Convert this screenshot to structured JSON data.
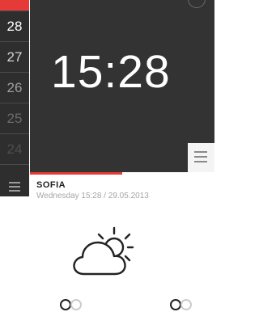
{
  "sidebar": {
    "numbers": [
      "28",
      "27",
      "26",
      "25",
      "24"
    ],
    "colors": [
      "#ffffff",
      "#d4d4d4",
      "#9e9e9e",
      "#6a6a6a",
      "#4e4e4e"
    ],
    "menu_icon": "hamburger-icon"
  },
  "main": {
    "clock": "15:28",
    "top_icon": "circle-button-icon",
    "menu_icon": "hamburger-icon"
  },
  "location": {
    "city": "SOFIA",
    "datetime": "Wednesday 15:28 / 29.05.2013"
  },
  "weather": {
    "icon": "partly-cloudy-icon"
  },
  "theme": {
    "accent": "#e53a37",
    "dark": "#333333",
    "sidebar": "#2e2e2e"
  }
}
